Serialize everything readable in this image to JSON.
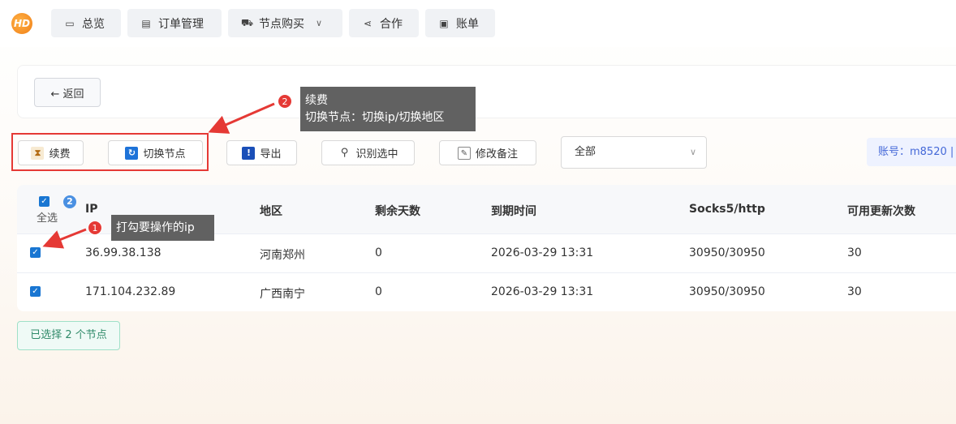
{
  "nav": {
    "logo_text": "HD",
    "items": [
      {
        "label": "总览",
        "icon": "monitor-icon"
      },
      {
        "label": "订单管理",
        "icon": "document-icon"
      },
      {
        "label": "节点购买",
        "icon": "cart-icon"
      },
      {
        "label": "合作",
        "icon": "share-icon"
      },
      {
        "label": "账单",
        "icon": "bill-icon"
      }
    ]
  },
  "back_button": {
    "label": "← 返回"
  },
  "toolbar": {
    "renew": "续费",
    "switch_node": "切换节点",
    "export": "导出",
    "recognize": "识别选中",
    "edit_note": "修改备注",
    "filter_value": "全部",
    "account": "账号：m8520 |"
  },
  "annotations": {
    "renew_tip": {
      "number": "2",
      "line1": "续费",
      "line2": "切换节点：切换ip/切换地区"
    },
    "select_tip": {
      "number": "1",
      "text": "打勾要操作的ip"
    }
  },
  "table": {
    "select_all_label": "全选",
    "selected_count": "2",
    "columns": [
      "IP",
      "地区",
      "剩余天数",
      "到期时间",
      "Socks5/http",
      "可用更新次数"
    ],
    "rows": [
      {
        "checked": true,
        "ip": "36.99.38.138",
        "region": "河南郑州",
        "days": "0",
        "expire": "2026-03-29 13:31",
        "ports": "30950/30950",
        "updates": "30"
      },
      {
        "checked": true,
        "ip": "171.104.232.89",
        "region": "广西南宁",
        "days": "0",
        "expire": "2026-03-29 13:31",
        "ports": "30950/30950",
        "updates": "30"
      }
    ]
  },
  "selection_info": "已选择 2 个节点",
  "colors": {
    "accent": "#1976d2",
    "annotation_red": "#e53935",
    "tooltip_bg": "#616161"
  }
}
